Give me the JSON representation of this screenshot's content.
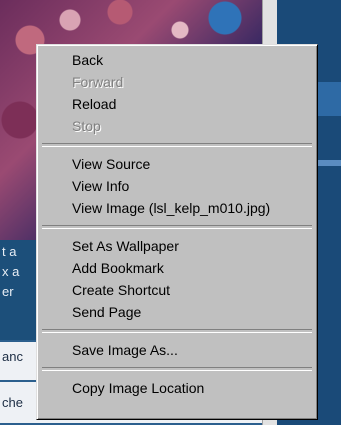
{
  "background": {
    "body_lines": [
      "t a",
      "x a",
      "er"
    ],
    "strip_lines": [
      "anc",
      "che"
    ]
  },
  "context_menu": {
    "groups": [
      [
        {
          "name": "back",
          "label": "Back",
          "disabled": false
        },
        {
          "name": "forward",
          "label": "Forward",
          "disabled": true
        },
        {
          "name": "reload",
          "label": "Reload",
          "disabled": false
        },
        {
          "name": "stop",
          "label": "Stop",
          "disabled": true
        }
      ],
      [
        {
          "name": "view-source",
          "label": "View Source",
          "disabled": false
        },
        {
          "name": "view-info",
          "label": "View Info",
          "disabled": false
        },
        {
          "name": "view-image",
          "label": "View Image (lsl_kelp_m010.jpg)",
          "disabled": false
        }
      ],
      [
        {
          "name": "set-as-wallpaper",
          "label": "Set As Wallpaper",
          "disabled": false
        },
        {
          "name": "add-bookmark",
          "label": "Add Bookmark",
          "disabled": false
        },
        {
          "name": "create-shortcut",
          "label": "Create Shortcut",
          "disabled": false
        },
        {
          "name": "send-page",
          "label": "Send Page",
          "disabled": false
        }
      ],
      [
        {
          "name": "save-image-as",
          "label": "Save Image As...",
          "disabled": false
        }
      ],
      [
        {
          "name": "copy-image-location",
          "label": "Copy Image Location",
          "disabled": false
        }
      ]
    ]
  }
}
